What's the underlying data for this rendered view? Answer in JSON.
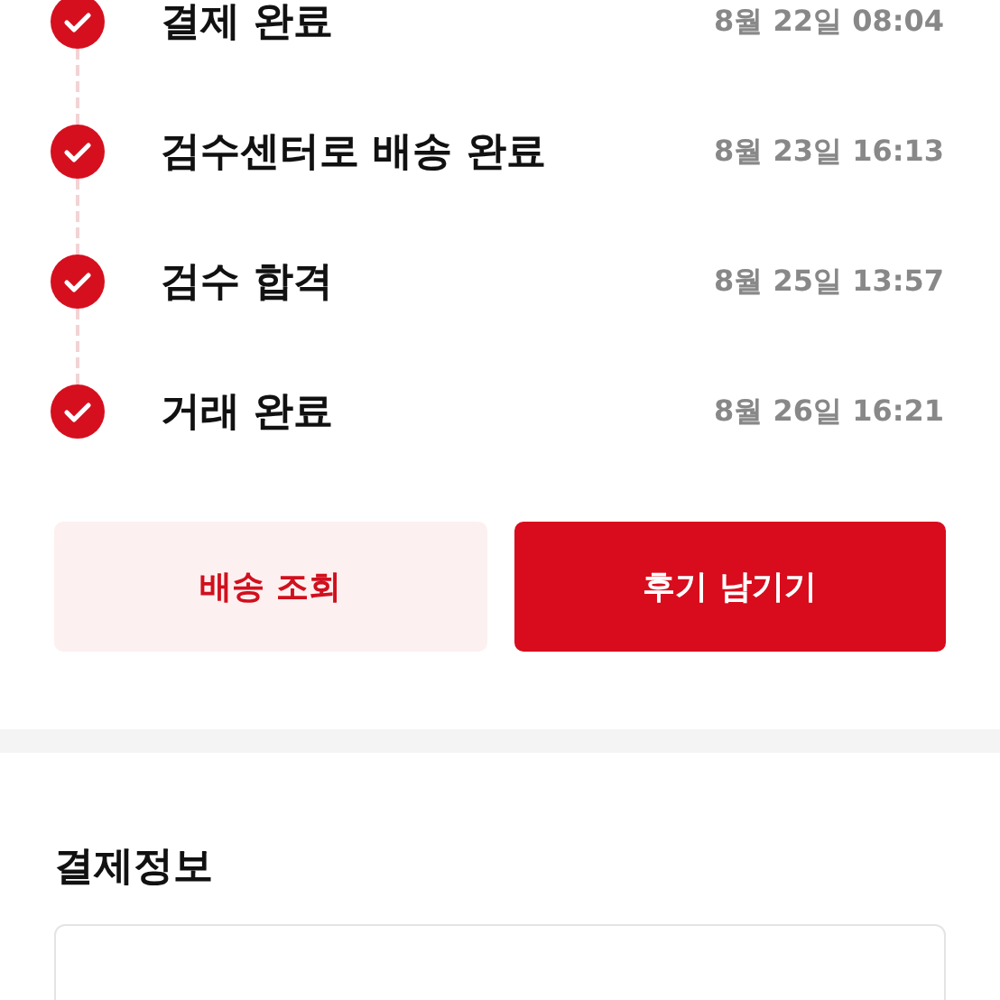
{
  "steps": [
    {
      "label": "결제 완료",
      "date": "8월 22일 08:04",
      "done": true
    },
    {
      "label": "검수센터로 배송 완료",
      "date": "8월 23일 16:13",
      "done": true
    },
    {
      "label": "검수 합격",
      "date": "8월 25일 13:57",
      "done": true
    },
    {
      "label": "거래 완료",
      "date": "8월 26일 16:21",
      "done": true
    }
  ],
  "buttons": [
    {
      "label": "배송 조회",
      "kind": "secondary"
    },
    {
      "label": "후기 남기기",
      "kind": "primary"
    }
  ],
  "payment_section": {
    "title": "결제정보"
  }
}
